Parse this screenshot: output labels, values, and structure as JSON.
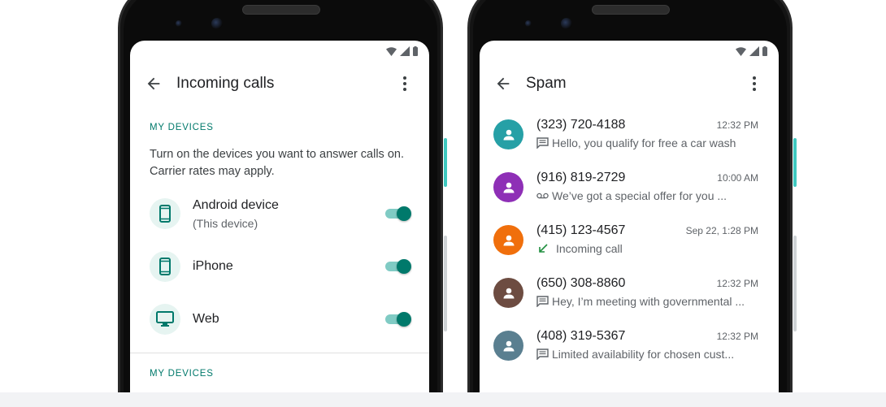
{
  "left_screen": {
    "title": "Incoming calls",
    "section_1_header": "MY DEVICES",
    "description": "Turn on the devices you want to answer calls on. Carrier rates may apply.",
    "devices": [
      {
        "name": "Android device",
        "subtitle": "(This device)",
        "icon": "phone-android-icon",
        "enabled": true
      },
      {
        "name": "iPhone",
        "subtitle": "",
        "icon": "phone-iphone-icon",
        "enabled": true
      },
      {
        "name": "Web",
        "subtitle": "",
        "icon": "desktop-icon",
        "enabled": true
      }
    ],
    "section_2_header": "MY DEVICES"
  },
  "right_screen": {
    "title": "Spam",
    "calls": [
      {
        "number": "(323) 720-4188",
        "time": "12:32 PM",
        "snippet": "Hello, you qualify for free a car wash",
        "type": "message-icon",
        "avatar_color": "#26a0a6"
      },
      {
        "number": "(916) 819-2729",
        "time": "10:00 AM",
        "snippet": "We’ve got a special offer for you ...",
        "type": "voicemail-icon",
        "avatar_color": "#8e2fb6"
      },
      {
        "number": "(415) 123-4567",
        "time": "Sep 22, 1:28 PM",
        "snippet": "Incoming call",
        "type": "incoming-call-icon",
        "avatar_color": "#f06f0c"
      },
      {
        "number": "(650) 308-8860",
        "time": "12:32 PM",
        "snippet": "Hey, I’m meeting with governmental ...",
        "type": "message-icon",
        "avatar_color": "#6d4c41"
      },
      {
        "number": "(408) 319-5367",
        "time": "12:32 PM",
        "snippet": "Limited availability for chosen cust...",
        "type": "message-icon",
        "avatar_color": "#5a7f90"
      }
    ]
  },
  "colors": {
    "accent": "#00796b",
    "toggle_track": "#80cbc4",
    "icon_bg": "#e6f4f1",
    "incoming_green": "#1e8e3e"
  }
}
